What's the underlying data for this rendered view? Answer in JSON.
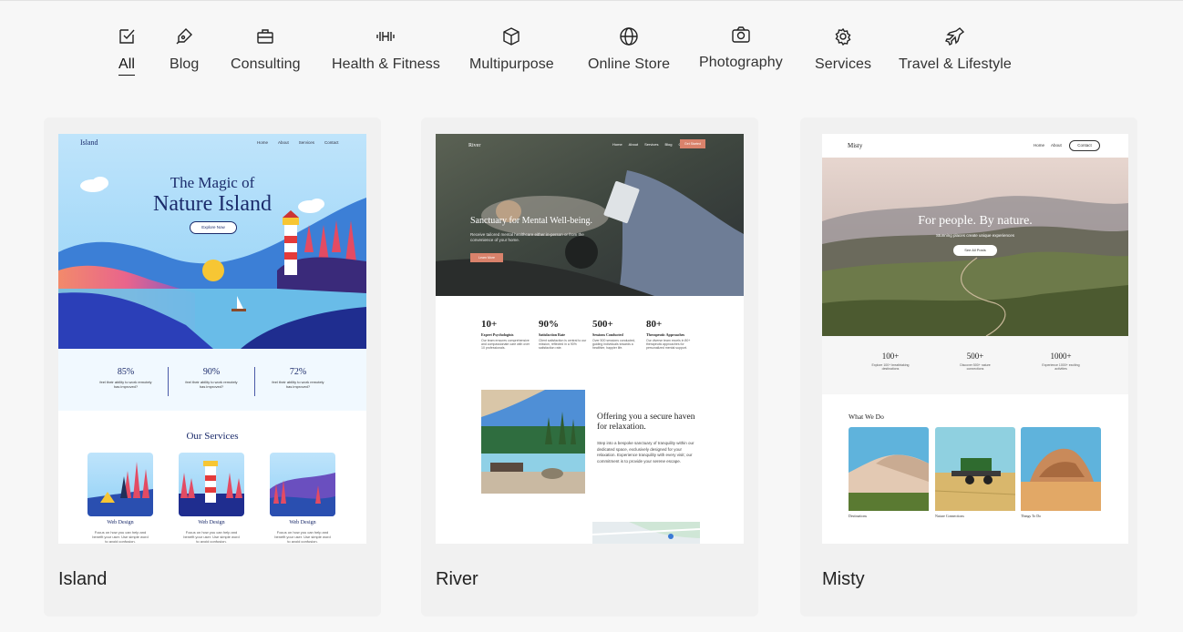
{
  "tabs": [
    {
      "label": "All",
      "icon": "all-templates-icon",
      "active": true
    },
    {
      "label": "Blog",
      "icon": "pen-icon"
    },
    {
      "label": "Consulting",
      "icon": "briefcase-icon"
    },
    {
      "label": "Health & Fitness",
      "icon": "dumbbell-icon"
    },
    {
      "label": "Multipurpose",
      "icon": "cube-icon"
    },
    {
      "label": "Online Store",
      "icon": "globe-icon"
    },
    {
      "label": "Photography",
      "icon": "camera-icon"
    },
    {
      "label": "Services",
      "icon": "gear-icon"
    },
    {
      "label": "Travel & Lifestyle",
      "icon": "airplane-icon"
    }
  ],
  "cards": [
    {
      "name": "Island",
      "preview": {
        "logo": "Island",
        "nav": [
          "Home",
          "About",
          "Services",
          "Contact"
        ],
        "hero_line1": "The Magic of",
        "hero_line2": "Nature Island",
        "cta": "Explore Now",
        "stats": [
          {
            "value": "85%",
            "label": "feel their ability to work remotely has improved?"
          },
          {
            "value": "90%",
            "label": "feel their ability to work remotely has improved?"
          },
          {
            "value": "72%",
            "label": "feel their ability to work remotely has improved?"
          }
        ],
        "services_title": "Our Services",
        "services": [
          {
            "title": "Web Design",
            "text": "Focus on how you can help and benefit your user. Use simple word to avoid confusion."
          },
          {
            "title": "Web Design",
            "text": "Focus on how you can help and benefit your user. Use simple word to avoid confusion."
          },
          {
            "title": "Web Design",
            "text": "Focus on how you can help and benefit your user. Use simple word to avoid confusion."
          }
        ]
      }
    },
    {
      "name": "River",
      "preview": {
        "logo": "River",
        "nav": [
          "Home",
          "About",
          "Services",
          "Blog",
          "Contact"
        ],
        "nav_button": "Get Started",
        "hero_title": "Sanctuary for Mental Well-being.",
        "hero_text": "Receive tailored mental healthcare either in-person or from the convenience of your home.",
        "cta": "Learn More",
        "stats": [
          {
            "value": "10+",
            "label": "Expert Psychologists",
            "text": "Our team ensures comprehensive and compassionate care with over 10 professionals."
          },
          {
            "value": "90%",
            "label": "Satisfaction Rate",
            "text": "Client satisfaction is central to our mission, reflected in a 90% satisfaction rate."
          },
          {
            "value": "500+",
            "label": "Sessions Conducted",
            "text": "Over 500 sessions conducted, guiding individuals towards a healthier, happier life."
          },
          {
            "value": "80+",
            "label": "Therapeutic Approaches",
            "text": "Our diverse team excels in 80+ therapeutic approaches for personalized mental support."
          }
        ],
        "feature_title": "Offering you a secure haven for relaxation.",
        "feature_text": "Step into a bespoke sanctuary of tranquility within our dedicated space, exclusively designed for your relaxation. Experience tranquility with every visit; our commitment is to provide your serene escape."
      }
    },
    {
      "name": "Misty",
      "preview": {
        "logo": "Misty",
        "nav": [
          "Home",
          "About"
        ],
        "nav_button": "Contact",
        "hero_title": "For people. By nature.",
        "hero_text": "Stunning places create unique experiences",
        "cta": "See All Posts",
        "stats": [
          {
            "value": "100+",
            "label": "Explore 100+ breathtaking destinations"
          },
          {
            "value": "500+",
            "label": "Discover 500+ nature connections"
          },
          {
            "value": "1000+",
            "label": "Experience 1000+ exciting activities"
          }
        ],
        "section_title": "What We Do",
        "items": [
          "Destinations",
          "Nature Connections",
          "Things To Do"
        ]
      }
    }
  ]
}
